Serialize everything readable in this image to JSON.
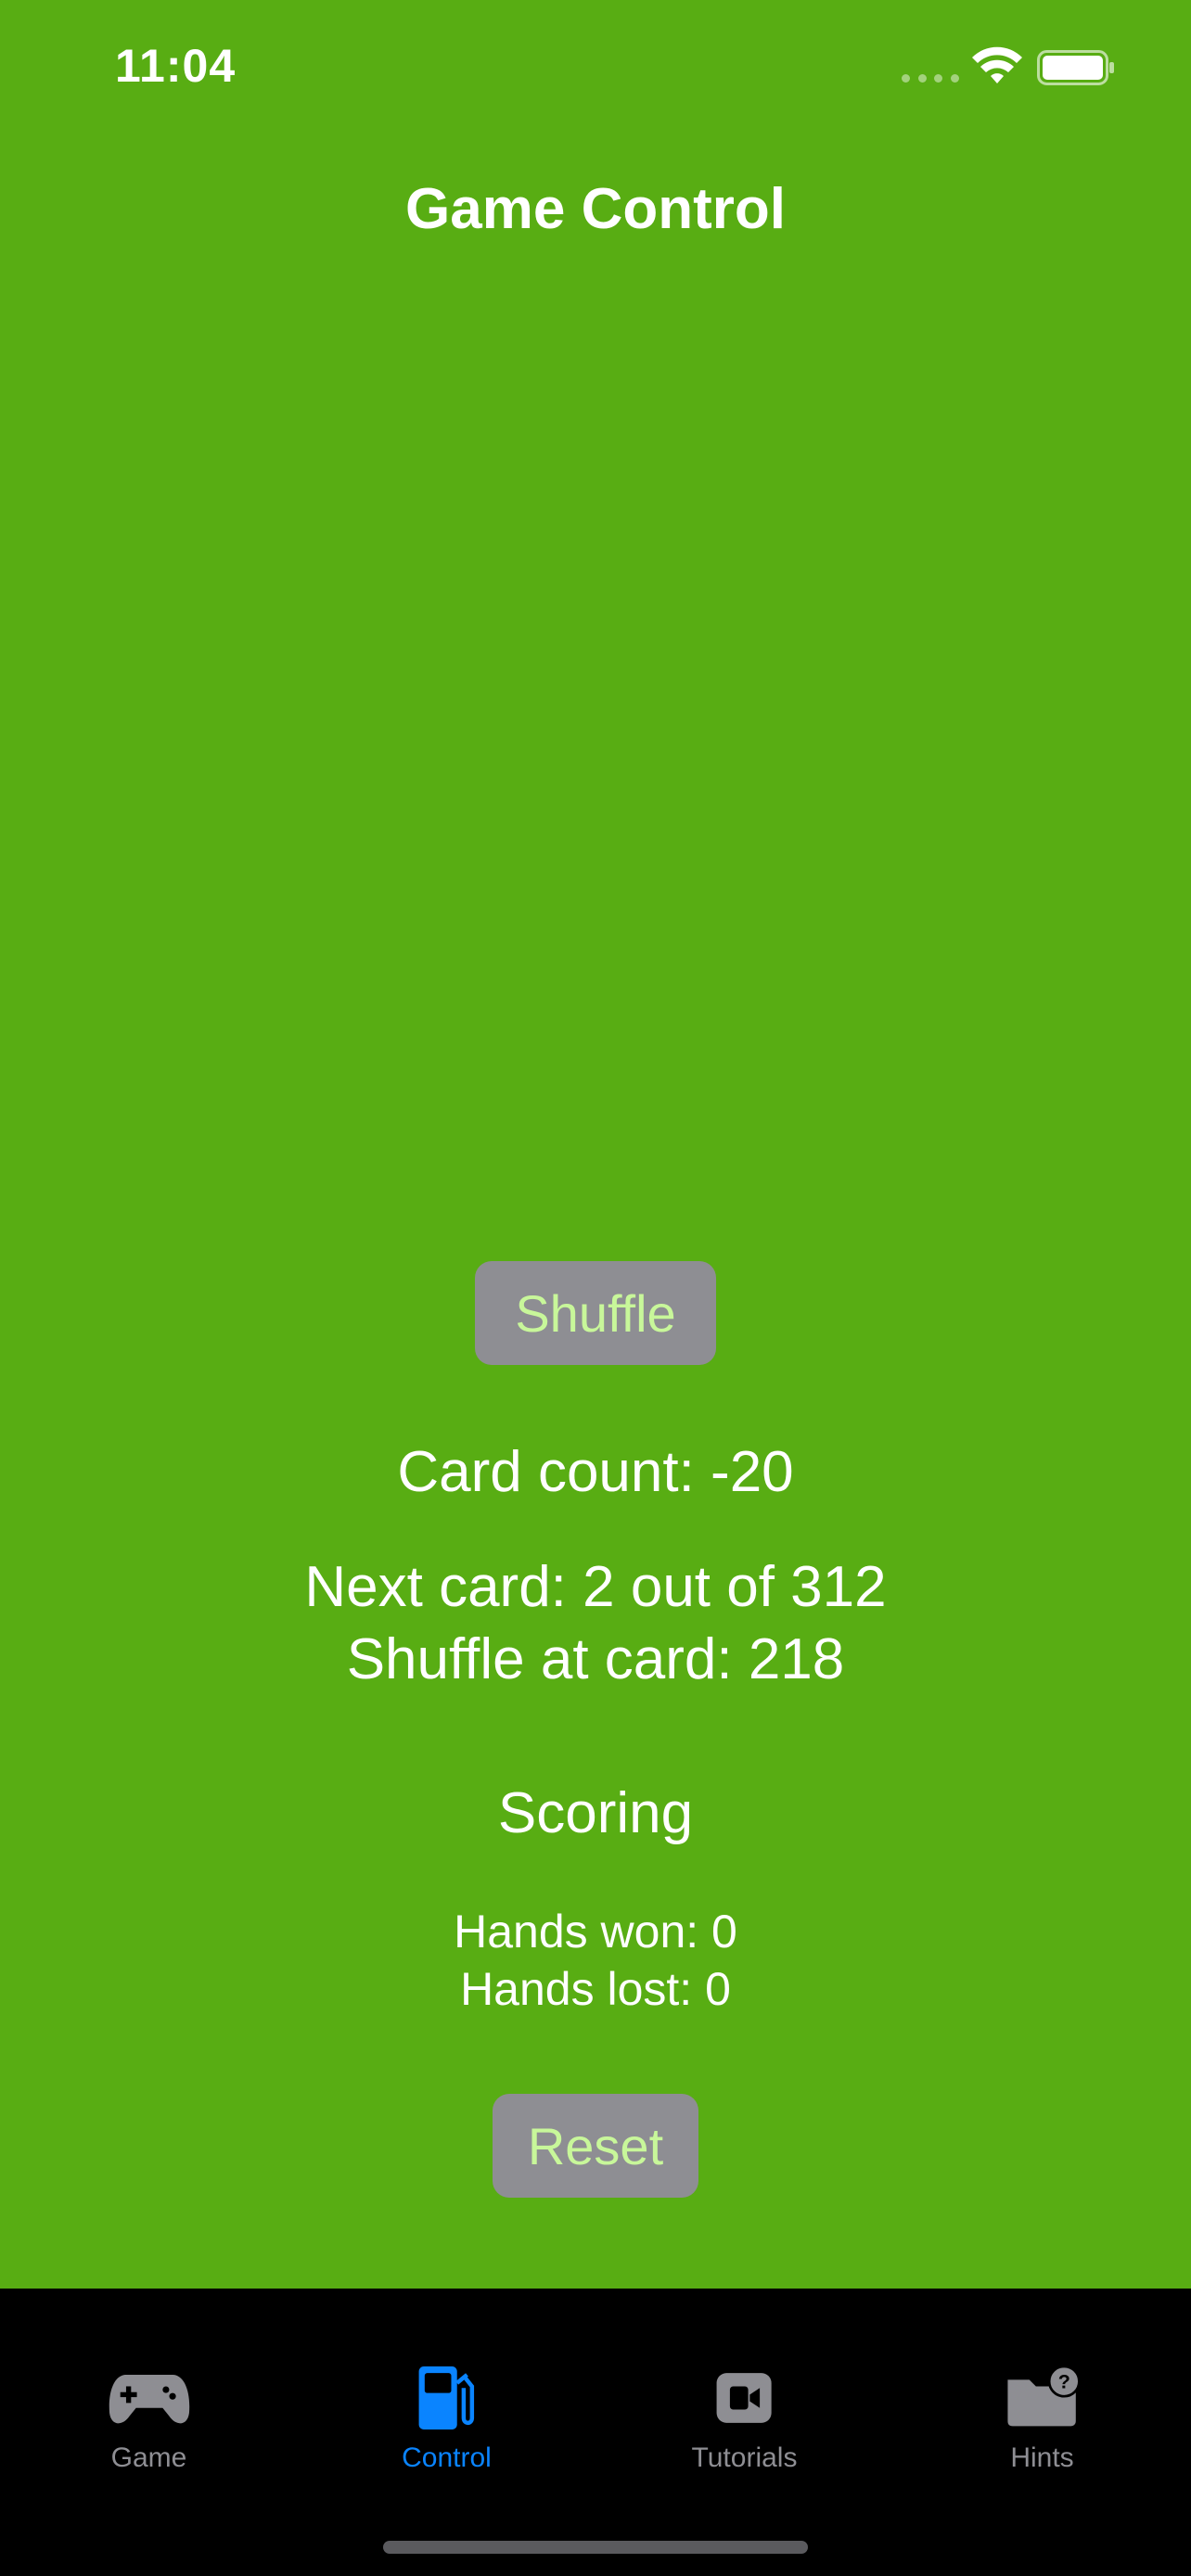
{
  "status_bar": {
    "time": "11:04"
  },
  "nav": {
    "title": "Game Control"
  },
  "controls": {
    "shuffle_label": "Shuffle",
    "card_count": "Card count: -20",
    "next_card": "Next card: 2 out of 312",
    "shuffle_at": "Shuffle at card: 218",
    "scoring_title": "Scoring",
    "hands_won": "Hands won: 0",
    "hands_lost": "Hands lost: 0",
    "reset_label": "Reset"
  },
  "tabs": [
    {
      "label": "Game",
      "icon": "gamecontroller-icon",
      "active": false
    },
    {
      "label": "Control",
      "icon": "fuel-pump-icon",
      "active": true
    },
    {
      "label": "Tutorials",
      "icon": "video-camera-icon",
      "active": false
    },
    {
      "label": "Hints",
      "icon": "folder-question-icon",
      "active": false
    }
  ],
  "colors": {
    "background": "#58ad13",
    "button_bg": "#8e8e93",
    "button_text": "#c8f79a",
    "tab_active": "#0a84ff",
    "tab_inactive": "#8e8e93"
  }
}
